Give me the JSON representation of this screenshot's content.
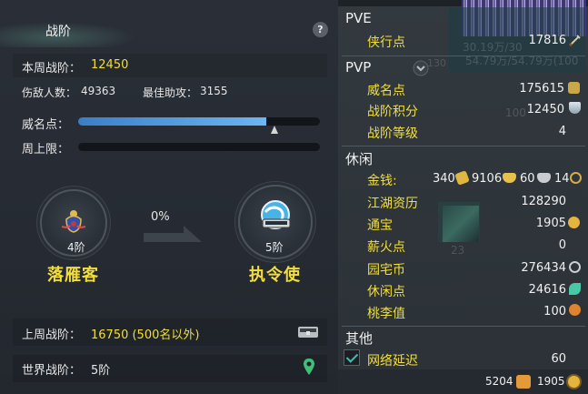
{
  "left": {
    "title": "战阶",
    "help": "?",
    "this_week_label": "本周战阶：",
    "this_week_value": "12450",
    "kills_label": "伤敌人数：",
    "kills_value": "49363",
    "assist_label": "最佳助攻：",
    "assist_value": "3155",
    "prestige_label": "威名点：",
    "prestige_fraction": 0.78,
    "weekly_cap_label": "周上限：",
    "weekly_cap_fraction": 0.0,
    "current_rank": {
      "level": "4阶",
      "name": "落雁客"
    },
    "progress_percent": "0%",
    "next_rank": {
      "level": "5阶",
      "name": "执令使"
    },
    "last_week_label": "上周战阶：",
    "last_week_value": "16750 (500名以外)",
    "world_rank_label": "世界战阶：",
    "world_rank_value": "5阶"
  },
  "right": {
    "pve": {
      "title": "PVE",
      "items": [
        {
          "label": "侠行点",
          "value": "17816"
        }
      ],
      "faint": "30.19万/30",
      "faint2": "54.79万/54.79万(100"
    },
    "pvp": {
      "title": "PVP",
      "badge": "130",
      "items": [
        {
          "label": "威名点",
          "value": "175615"
        },
        {
          "label": "战阶积分",
          "value": "12450"
        },
        {
          "label": "战阶等级",
          "value": "4"
        }
      ],
      "faint": "100"
    },
    "leisure": {
      "title": "休闲",
      "money_label": "金钱:",
      "money": [
        "340",
        "9106",
        "60",
        "14"
      ],
      "items": [
        {
          "label": "江湖资历",
          "value": "128290"
        },
        {
          "label": "通宝",
          "value": "1905"
        },
        {
          "label": "薪火点",
          "value": "0"
        },
        {
          "label": "园宅币",
          "value": "276434"
        },
        {
          "label": "休闲点",
          "value": "24616"
        },
        {
          "label": "桃李值",
          "value": "100"
        }
      ],
      "faint": "23"
    },
    "other": {
      "title": "其他",
      "network_label": "网络延迟",
      "network_value": "60"
    },
    "footer": {
      "left_value": "5204",
      "right_value": "1905"
    }
  },
  "colors": {
    "accent_yellow": "#f2de3a",
    "bar_blue": "#4a90d9",
    "teal": "#36c2b4"
  }
}
